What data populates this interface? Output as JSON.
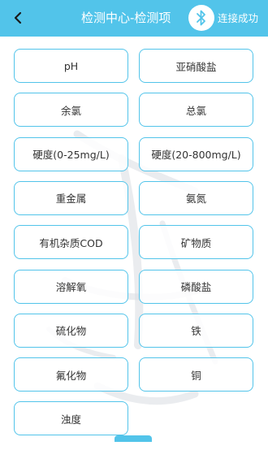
{
  "header": {
    "title": "检测中心-检测项",
    "status": "连接成功",
    "back_icon": "chevron-left-icon",
    "bluetooth_icon": "bluetooth-icon"
  },
  "colors": {
    "accent": "#52c4ea",
    "text": "#333333"
  },
  "items": [
    {
      "label": "pH"
    },
    {
      "label": "亚硝酸盐"
    },
    {
      "label": "余氯"
    },
    {
      "label": "总氯"
    },
    {
      "label": "硬度(0-25mg/L)"
    },
    {
      "label": "硬度(20-800mg/L)"
    },
    {
      "label": "重金属"
    },
    {
      "label": "氨氮"
    },
    {
      "label": "有机杂质COD"
    },
    {
      "label": "矿物质"
    },
    {
      "label": "溶解氧"
    },
    {
      "label": "磷酸盐"
    },
    {
      "label": "硫化物"
    },
    {
      "label": "铁"
    },
    {
      "label": "氟化物"
    },
    {
      "label": "铜"
    },
    {
      "label": "浊度"
    }
  ]
}
